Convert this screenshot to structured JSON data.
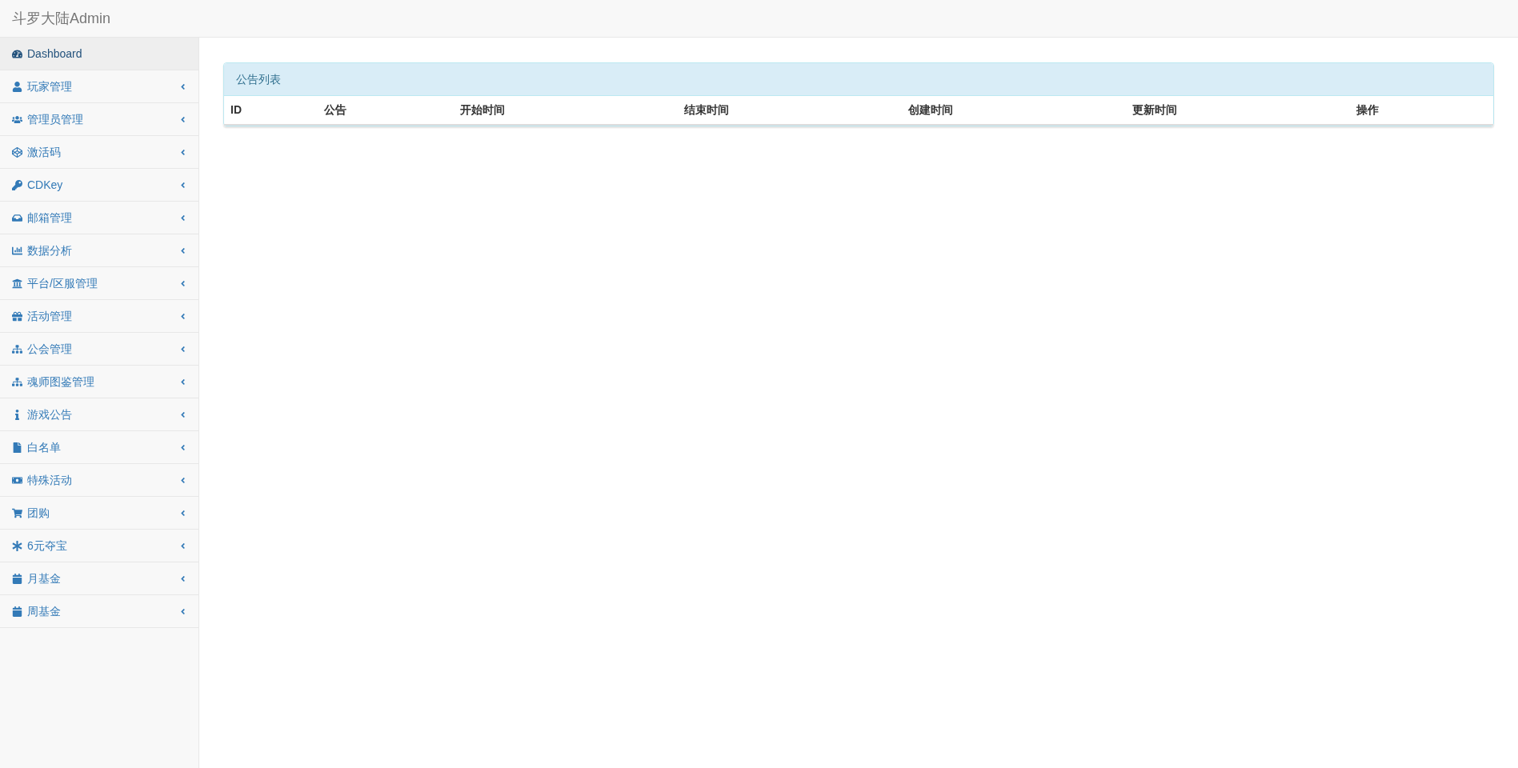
{
  "navbar": {
    "brand": "斗罗大陆Admin"
  },
  "sidebar": {
    "items": [
      {
        "label": "Dashboard",
        "selected": true,
        "expandable": false
      },
      {
        "label": "玩家管理",
        "selected": false,
        "expandable": true
      },
      {
        "label": "管理员管理",
        "selected": false,
        "expandable": true
      },
      {
        "label": "激活码",
        "selected": false,
        "expandable": true
      },
      {
        "label": "CDKey",
        "selected": false,
        "expandable": true
      },
      {
        "label": "邮箱管理",
        "selected": false,
        "expandable": true
      },
      {
        "label": "数据分析",
        "selected": false,
        "expandable": true
      },
      {
        "label": "平台/区服管理",
        "selected": false,
        "expandable": true
      },
      {
        "label": "活动管理",
        "selected": false,
        "expandable": true
      },
      {
        "label": "公会管理",
        "selected": false,
        "expandable": true
      },
      {
        "label": "魂师图鉴管理",
        "selected": false,
        "expandable": true
      },
      {
        "label": "游戏公告",
        "selected": false,
        "expandable": true
      },
      {
        "label": "白名单",
        "selected": false,
        "expandable": true
      },
      {
        "label": "特殊活动",
        "selected": false,
        "expandable": true
      },
      {
        "label": "团购",
        "selected": false,
        "expandable": true
      },
      {
        "label": "6元夺宝",
        "selected": false,
        "expandable": true
      },
      {
        "label": "月基金",
        "selected": false,
        "expandable": true
      },
      {
        "label": "周基金",
        "selected": false,
        "expandable": true
      }
    ]
  },
  "panel": {
    "title": "公告列表",
    "table": {
      "columns": [
        "ID",
        "公告",
        "开始时间",
        "结束时间",
        "创建时间",
        "更新时间",
        "操作"
      ]
    }
  }
}
